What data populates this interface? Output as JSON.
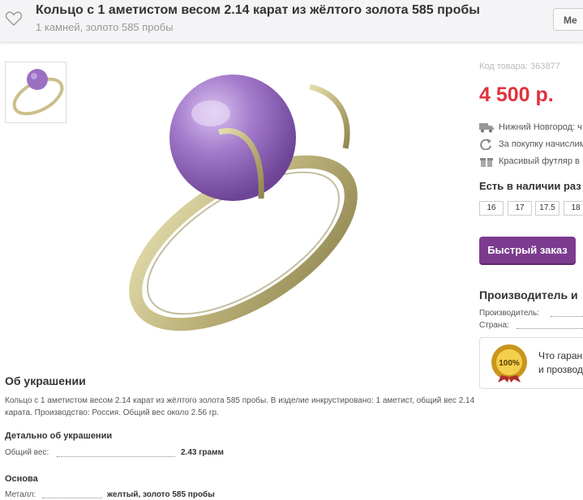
{
  "header": {
    "title": "Кольцо с 1 аметистом весом 2.14 карат из жёлтого золота 585 пробы",
    "subtitle": "1 камней, золото 585 пробы",
    "right_button": "Ме"
  },
  "product": {
    "code": "Код товара: 363877",
    "price": "4 500 р.",
    "features": [
      {
        "icon": "truck-icon",
        "text": "Нижний Новгород: ч"
      },
      {
        "icon": "refresh-icon",
        "text": "За покупку начислим"
      },
      {
        "icon": "gift-icon",
        "text": "Красивый футляр в"
      }
    ],
    "stock_title": "Есть в наличии раз",
    "sizes": [
      "16",
      "17",
      "17.5",
      "18"
    ],
    "quick_order": "Быстрый заказ"
  },
  "manufacturer": {
    "title": "Производитель и",
    "maker_label": "Производитель:",
    "country_label": "Страна:",
    "guarantee_line1": "Что гаран",
    "guarantee_line2": "и прозвод",
    "badge_text": "100%"
  },
  "about": {
    "title": "Об украшении",
    "text": "Кольцо с 1 аметистом весом 2.14 карат из жёлтого золота 585 пробы. В изделие инкрустировано: 1 аметист, общий вес 2.14 карата. Производство: Россия. Общий вес около 2.56 гр.",
    "details_title": "Детально об украшении",
    "weight_label": "Общий вес:",
    "weight_value": "2.43 грамм",
    "base_title": "Основа",
    "metal_label": "Металл:",
    "metal_value": "желтый, золото 585 пробы"
  },
  "colors": {
    "price": "#e0333d",
    "order_button": "#7c3b8f",
    "gem": "#9b6fc2",
    "gold": "#c9c08a"
  }
}
